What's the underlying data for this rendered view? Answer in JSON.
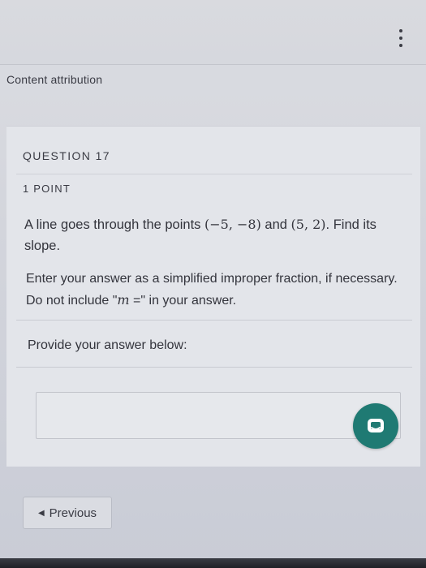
{
  "header": {
    "menu_icon": "kebab-menu-icon",
    "attribution_label": "Content attribution"
  },
  "question": {
    "number_label": "QUESTION 17",
    "points_label": "1 POINT",
    "prompt_before": "A line goes through the points ",
    "point_a": "(−5, −8)",
    "prompt_and": " and ",
    "point_b": "(5, 2)",
    "prompt_after": ". Find its slope.",
    "instructions_before": "Enter your answer as a simplified improper fraction, if necessary. Do not include \"",
    "instructions_math": "m",
    "instructions_eq": " =",
    "instructions_after": "\" in your answer."
  },
  "answer": {
    "label": "Provide your answer below:",
    "value": "",
    "placeholder": ""
  },
  "chat": {
    "icon": "chat-bubble-icon",
    "color": "#1f7a73"
  },
  "navigation": {
    "previous_label": "Previous",
    "previous_icon": "caret-left-icon"
  }
}
